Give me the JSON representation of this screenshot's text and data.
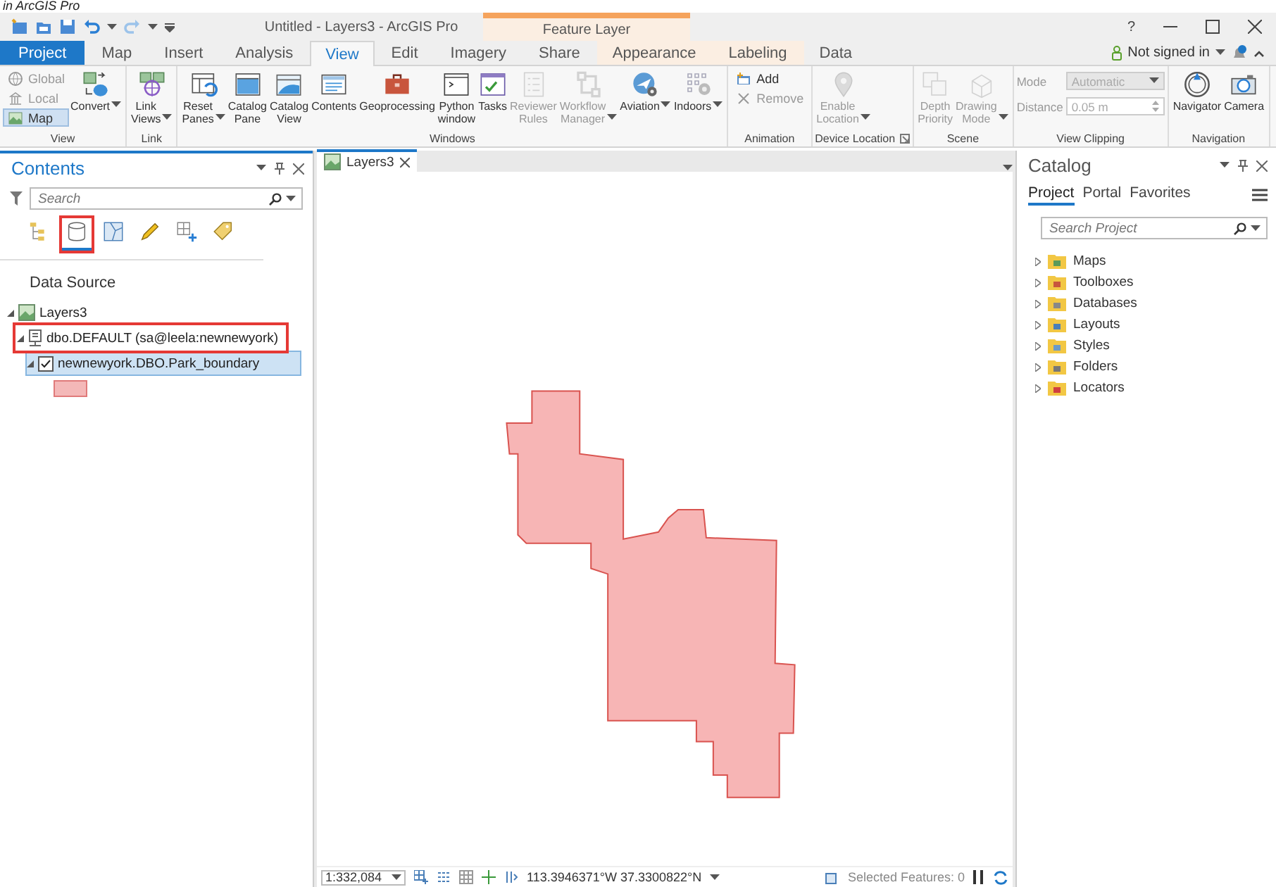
{
  "caption": "in ArcGIS Pro",
  "title_bar": {
    "title": "Untitled - Layers3 - ArcGIS Pro",
    "contextual_title": "Feature Layer",
    "help": "?"
  },
  "tabs": [
    {
      "label": "Project",
      "kind": "backstage",
      "selected": false
    },
    {
      "label": "Map",
      "kind": "core",
      "selected": false
    },
    {
      "label": "Insert",
      "kind": "core",
      "selected": false
    },
    {
      "label": "Analysis",
      "kind": "core",
      "selected": false
    },
    {
      "label": "View",
      "kind": "core",
      "selected": true
    },
    {
      "label": "Edit",
      "kind": "core",
      "selected": false
    },
    {
      "label": "Imagery",
      "kind": "core",
      "selected": false
    },
    {
      "label": "Share",
      "kind": "core",
      "selected": false
    },
    {
      "label": "Appearance",
      "kind": "contextual",
      "selected": false
    },
    {
      "label": "Labeling",
      "kind": "contextual",
      "selected": false
    },
    {
      "label": "Data",
      "kind": "contextual",
      "selected": false
    }
  ],
  "account": {
    "label": "Not signed in"
  },
  "ribbon": {
    "groups": [
      {
        "label": "View",
        "items": [
          {
            "kind": "small",
            "label": "Global",
            "disabled": true,
            "selected": false
          },
          {
            "kind": "small",
            "label": "Local",
            "disabled": true,
            "selected": false
          },
          {
            "kind": "small",
            "label": "Map",
            "disabled": false,
            "selected": true
          },
          {
            "kind": "large",
            "label": "Convert",
            "disabled": false,
            "dropdown": true
          }
        ]
      },
      {
        "label": "Link",
        "items": [
          {
            "kind": "large",
            "label": "Link Views",
            "disabled": false,
            "dropdown": true
          }
        ]
      },
      {
        "label": "Windows",
        "items": [
          {
            "kind": "large",
            "label": "Reset Panes",
            "disabled": false,
            "dropdown": true
          },
          {
            "kind": "large",
            "label": "Catalog Pane",
            "disabled": false
          },
          {
            "kind": "large",
            "label": "Catalog View",
            "disabled": false
          },
          {
            "kind": "large",
            "label": "Contents",
            "disabled": false
          },
          {
            "kind": "large",
            "label": "Geoprocessing",
            "disabled": false
          },
          {
            "kind": "large",
            "label": "Python window",
            "disabled": false
          },
          {
            "kind": "large",
            "label": "Tasks",
            "disabled": false
          },
          {
            "kind": "large",
            "label": "Reviewer Rules",
            "disabled": true
          },
          {
            "kind": "large",
            "label": "Workflow Manager",
            "disabled": true,
            "dropdown": true
          },
          {
            "kind": "large",
            "label": "Aviation",
            "disabled": false,
            "dropdown": true
          },
          {
            "kind": "large",
            "label": "Indoors",
            "disabled": false,
            "dropdown": true
          }
        ]
      },
      {
        "label": "Animation",
        "items": [
          {
            "kind": "small",
            "label": "Add",
            "disabled": false
          },
          {
            "kind": "small",
            "label": "Remove",
            "disabled": true
          }
        ]
      },
      {
        "label": "Device Location",
        "launcher": true,
        "items": [
          {
            "kind": "large",
            "label": "Enable Location",
            "disabled": true,
            "dropdown": true
          }
        ]
      },
      {
        "label": "Scene",
        "items": [
          {
            "kind": "large",
            "label": "Depth Priority",
            "disabled": true
          },
          {
            "kind": "large",
            "label": "Drawing Mode",
            "disabled": true,
            "dropdown": true
          }
        ]
      },
      {
        "label": "View Clipping",
        "items": [
          {
            "kind": "dropdown",
            "label": "Mode",
            "value": "Automatic",
            "disabled": true
          },
          {
            "kind": "spinner",
            "label": "Distance",
            "value": "0.05 m",
            "disabled": true
          }
        ]
      },
      {
        "label": "Navigation",
        "items": [
          {
            "kind": "large",
            "label": "Navigator",
            "disabled": false
          },
          {
            "kind": "large",
            "label": "Camera",
            "disabled": false
          }
        ]
      }
    ]
  },
  "contents": {
    "title": "Contents",
    "search": {
      "placeholder": "Search"
    },
    "views": [
      {
        "kind": "drawing-order",
        "selected": false,
        "annotated": false
      },
      {
        "kind": "data-source",
        "selected": true,
        "annotated": true
      },
      {
        "kind": "selection",
        "selected": false,
        "annotated": false
      },
      {
        "kind": "editing",
        "selected": false,
        "annotated": false
      },
      {
        "kind": "snapping",
        "selected": false,
        "annotated": false
      },
      {
        "kind": "labeling",
        "selected": false,
        "annotated": false
      }
    ],
    "heading": "Data Source",
    "tree": [
      {
        "label": "Layers3",
        "kind": "map",
        "expanded": true,
        "selected": false,
        "annotated": false,
        "children": [
          {
            "label": "dbo.DEFAULT (sa@leela:newnewyork)",
            "kind": "workspace",
            "expanded": true,
            "selected": false,
            "annotated": true,
            "children": [
              {
                "label": "newnewyork.DBO.Park_boundary",
                "kind": "layer",
                "expanded": true,
                "selected": true,
                "annotated": false,
                "checked": true
              }
            ]
          }
        ]
      }
    ]
  },
  "map_view": {
    "tab": {
      "label": "Layers3"
    },
    "status_bar": {
      "scale": "1:332,084",
      "coordinates": "113.3946371°W 37.3300822°N",
      "selected_features": "Selected Features: 0"
    }
  },
  "catalog": {
    "title": "Catalog",
    "tabs": [
      {
        "label": "Project",
        "selected": true
      },
      {
        "label": "Portal",
        "selected": false
      },
      {
        "label": "Favorites",
        "selected": false
      }
    ],
    "search": {
      "placeholder": "Search Project"
    },
    "items": [
      {
        "label": "Maps",
        "kind": "maps"
      },
      {
        "label": "Toolboxes",
        "kind": "toolboxes"
      },
      {
        "label": "Databases",
        "kind": "databases"
      },
      {
        "label": "Layouts",
        "kind": "layouts"
      },
      {
        "label": "Styles",
        "kind": "styles"
      },
      {
        "label": "Folders",
        "kind": "folders"
      },
      {
        "label": "Locators",
        "kind": "locators"
      }
    ]
  }
}
